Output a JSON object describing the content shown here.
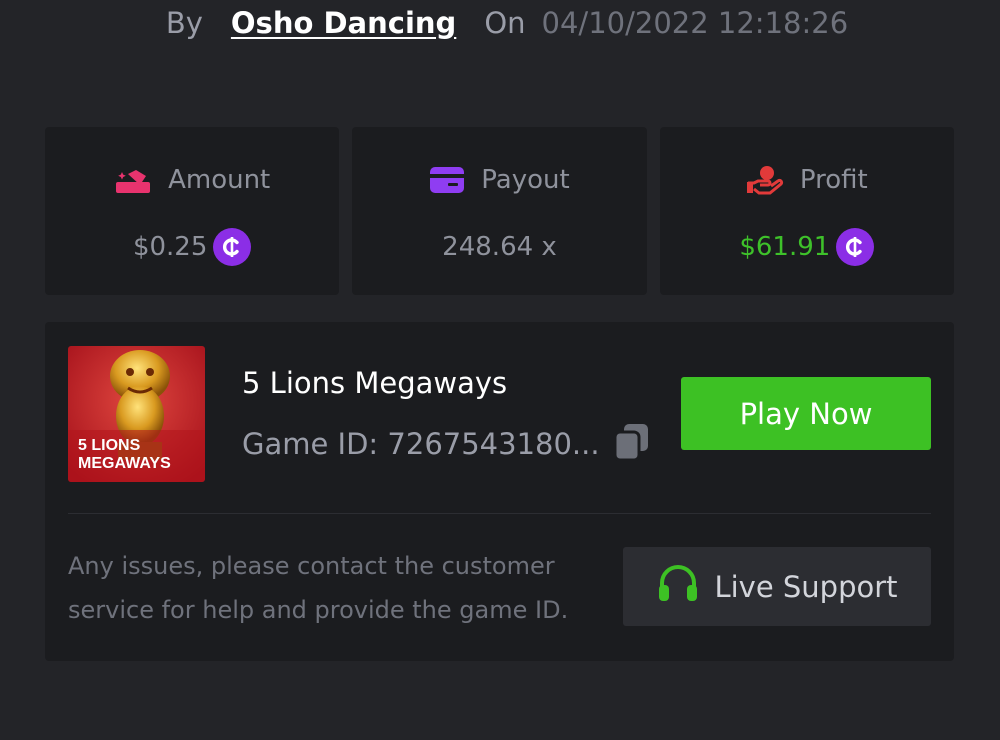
{
  "header": {
    "by_label": "By",
    "username": "Osho Dancing",
    "on_label": "On",
    "timestamp": "04/10/2022 12:18:26"
  },
  "stats": {
    "amount": {
      "label": "Amount",
      "value": "$0.25",
      "icon": "amount-icon"
    },
    "payout": {
      "label": "Payout",
      "value": "248.64 x",
      "icon": "card-icon"
    },
    "profit": {
      "label": "Profit",
      "value": "$61.91",
      "icon": "hand-coin-icon"
    }
  },
  "game": {
    "title": "5 Lions Megaways",
    "id_label": "Game ID: 7267543180...",
    "thumbnail_text_line1": "5 LIONS",
    "thumbnail_text_line2": "MEGAWAYS",
    "play_label": "Play Now"
  },
  "support": {
    "notice": "Any issues, please contact the customer service for help and provide the game ID.",
    "button_label": "Live Support"
  },
  "colors": {
    "background": "#232428",
    "card": "#1b1c1f",
    "accent_green": "#3dc124",
    "coin_purple": "#8b2ee6",
    "amount_pink": "#e8336e",
    "payout_purple": "#8f3df2",
    "profit_red": "#e23a3a"
  }
}
